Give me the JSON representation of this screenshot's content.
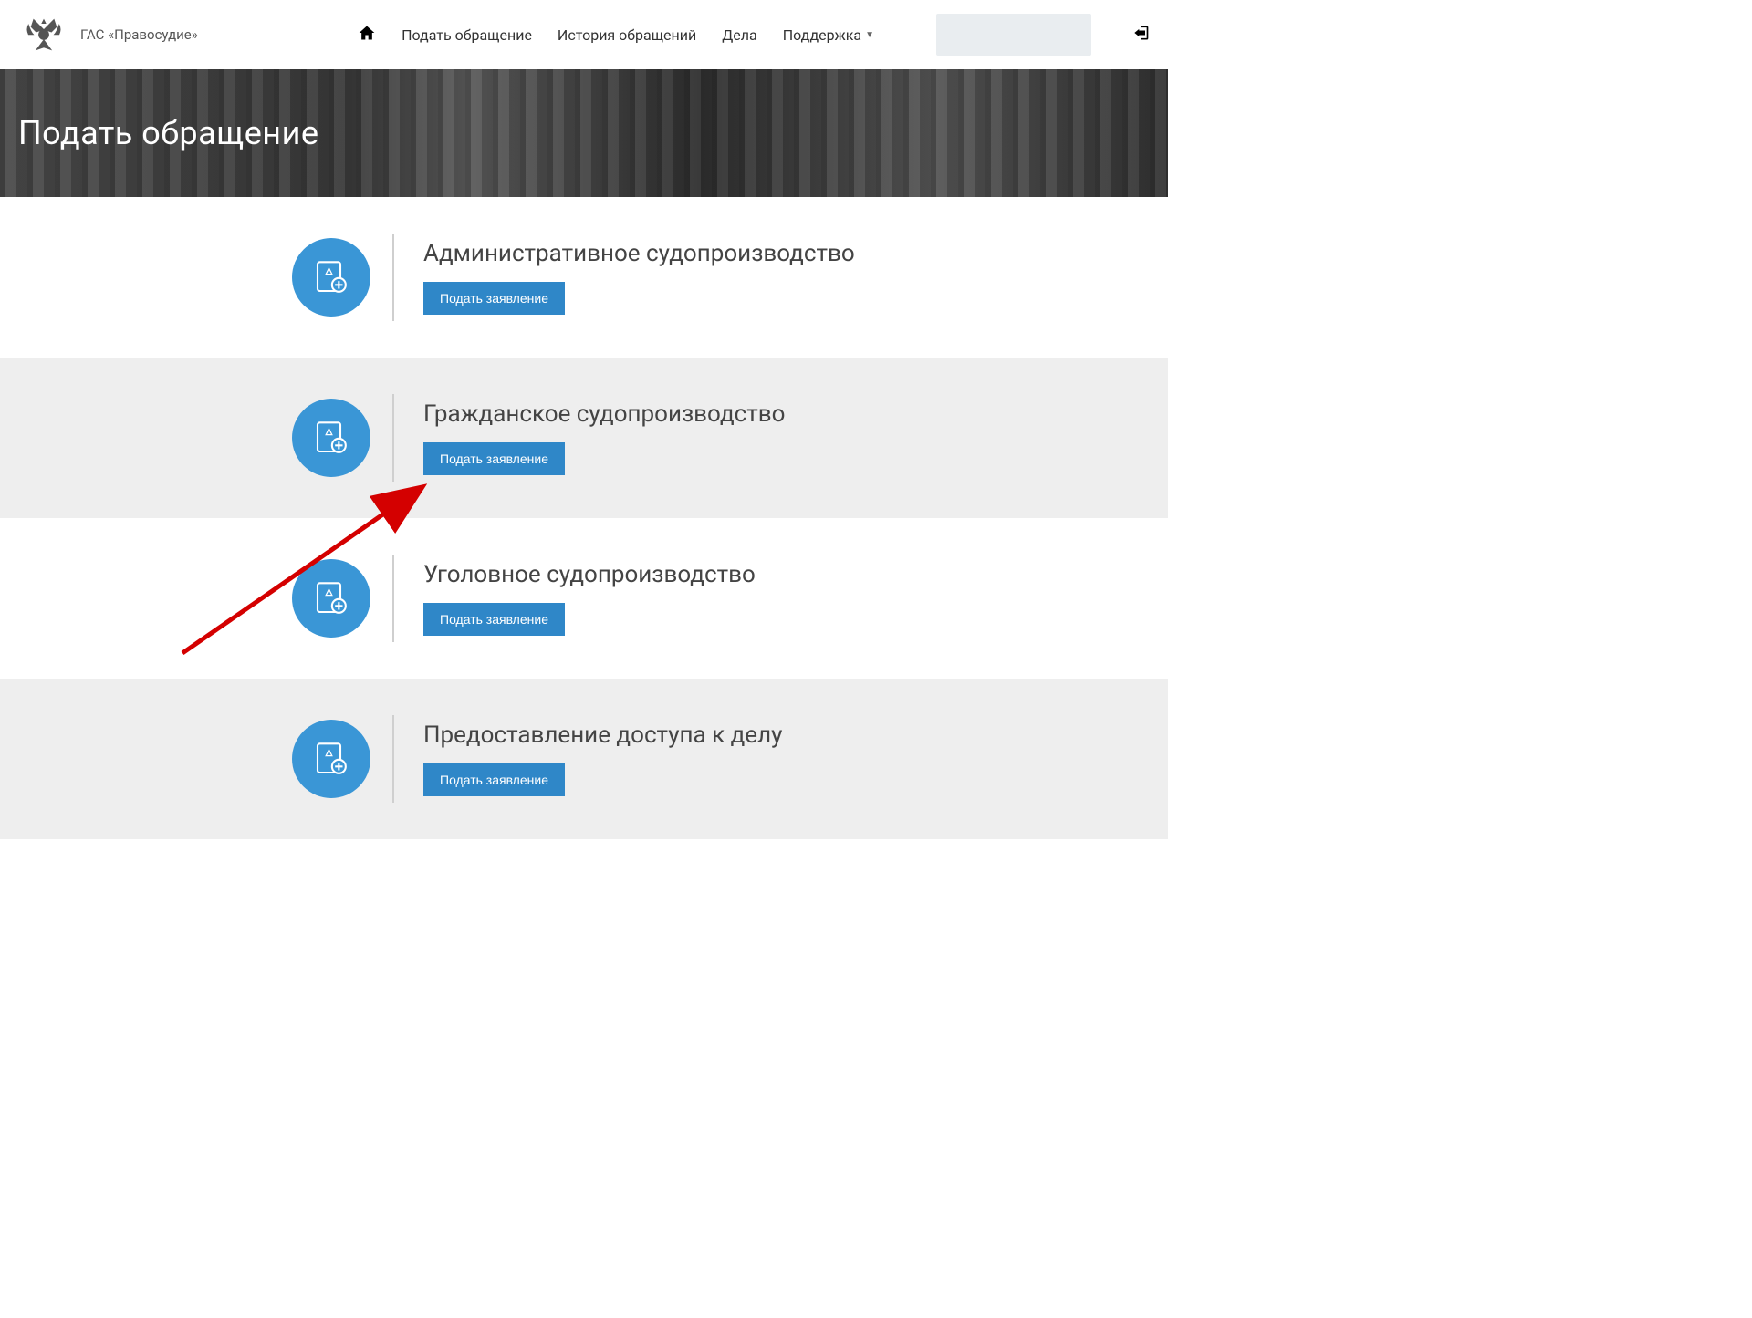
{
  "header": {
    "app_name": "ГАС «Правосудие»",
    "nav": {
      "submit": "Подать обращение",
      "history": "История обращений",
      "cases": "Дела",
      "support": "Поддержка"
    }
  },
  "hero": {
    "title": "Подать обращение"
  },
  "categories": [
    {
      "title": "Административное судопроизводство",
      "button": "Подать заявление"
    },
    {
      "title": "Гражданское судопроизводство",
      "button": "Подать заявление"
    },
    {
      "title": "Уголовное судопроизводство",
      "button": "Подать заявление"
    },
    {
      "title": "Предоставление доступа к делу",
      "button": "Подать заявление"
    }
  ]
}
